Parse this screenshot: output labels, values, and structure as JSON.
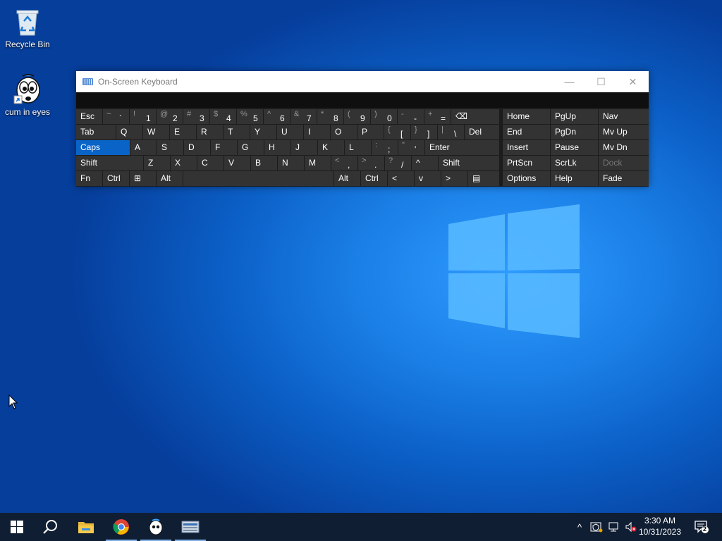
{
  "desktop": {
    "icons": [
      {
        "label": "Recycle Bin",
        "icon": "recycle-bin-icon"
      },
      {
        "label": "cum in eyes",
        "icon": "cartoon-face-shortcut-icon"
      }
    ]
  },
  "osk": {
    "title": "On-Screen Keyboard",
    "controls": {
      "minimize": "—",
      "maximize": "☐",
      "close": "✕"
    },
    "rows": [
      [
        {
          "l": "Esc"
        },
        {
          "s": "~",
          "p": "`"
        },
        {
          "s": "!",
          "p": "1"
        },
        {
          "s": "@",
          "p": "2"
        },
        {
          "s": "#",
          "p": "3"
        },
        {
          "s": "$",
          "p": "4"
        },
        {
          "s": "%",
          "p": "5"
        },
        {
          "s": "^",
          "p": "6"
        },
        {
          "s": "&",
          "p": "7"
        },
        {
          "s": "*",
          "p": "8"
        },
        {
          "s": "(",
          "p": "9"
        },
        {
          "s": ")",
          "p": "0"
        },
        {
          "s": "-",
          "p": "-"
        },
        {
          "s": "+",
          "p": "="
        },
        {
          "l": "⌫"
        }
      ],
      [
        {
          "l": "Tab"
        },
        {
          "l": "Q"
        },
        {
          "l": "W"
        },
        {
          "l": "E"
        },
        {
          "l": "R"
        },
        {
          "l": "T"
        },
        {
          "l": "Y"
        },
        {
          "l": "U"
        },
        {
          "l": "I"
        },
        {
          "l": "O"
        },
        {
          "l": "P"
        },
        {
          "s": "{",
          "p": "["
        },
        {
          "s": "}",
          "p": "]"
        },
        {
          "s": "|",
          "p": "\\"
        },
        {
          "l": "Del"
        }
      ],
      [
        {
          "l": "Caps"
        },
        {
          "l": "A"
        },
        {
          "l": "S"
        },
        {
          "l": "D"
        },
        {
          "l": "F"
        },
        {
          "l": "G"
        },
        {
          "l": "H"
        },
        {
          "l": "J"
        },
        {
          "l": "K"
        },
        {
          "l": "L"
        },
        {
          "s": ":",
          "p": ";"
        },
        {
          "s": "\"",
          "p": "'"
        },
        {
          "l": "Enter"
        }
      ],
      [
        {
          "l": "Shift"
        },
        {
          "l": "Z"
        },
        {
          "l": "X"
        },
        {
          "l": "C"
        },
        {
          "l": "V"
        },
        {
          "l": "B"
        },
        {
          "l": "N"
        },
        {
          "l": "M"
        },
        {
          "s": "<",
          "p": ","
        },
        {
          "s": ">",
          "p": "."
        },
        {
          "s": "?",
          "p": "/"
        },
        {
          "l": "^"
        },
        {
          "l": "Shift"
        }
      ],
      [
        {
          "l": "Fn"
        },
        {
          "l": "Ctrl"
        },
        {
          "l": "⊞"
        },
        {
          "l": "Alt"
        },
        {
          "l": ""
        },
        {
          "l": "Alt"
        },
        {
          "l": "Ctrl"
        },
        {
          "l": "<"
        },
        {
          "l": "v"
        },
        {
          "l": ">"
        },
        {
          "l": "▤"
        }
      ]
    ],
    "nav_rows": [
      [
        "Home",
        "PgUp",
        "Nav"
      ],
      [
        "End",
        "PgDn",
        "Mv Up"
      ],
      [
        "Insert",
        "Pause",
        "Mv Dn"
      ],
      [
        "PrtScn",
        "ScrLk",
        "Dock"
      ],
      [
        "Options",
        "Help",
        "Fade"
      ]
    ],
    "selected_key": "Caps",
    "disabled_key": "Dock"
  },
  "taskbar": {
    "items": [
      "start-icon",
      "search-icon",
      "file-explorer-icon",
      "chrome-icon",
      "cartoon-face-icon",
      "on-screen-keyboard-icon"
    ],
    "tray": {
      "chevron": "^",
      "time": "3:30 AM",
      "date": "10/31/2023",
      "notifications": "2"
    }
  }
}
